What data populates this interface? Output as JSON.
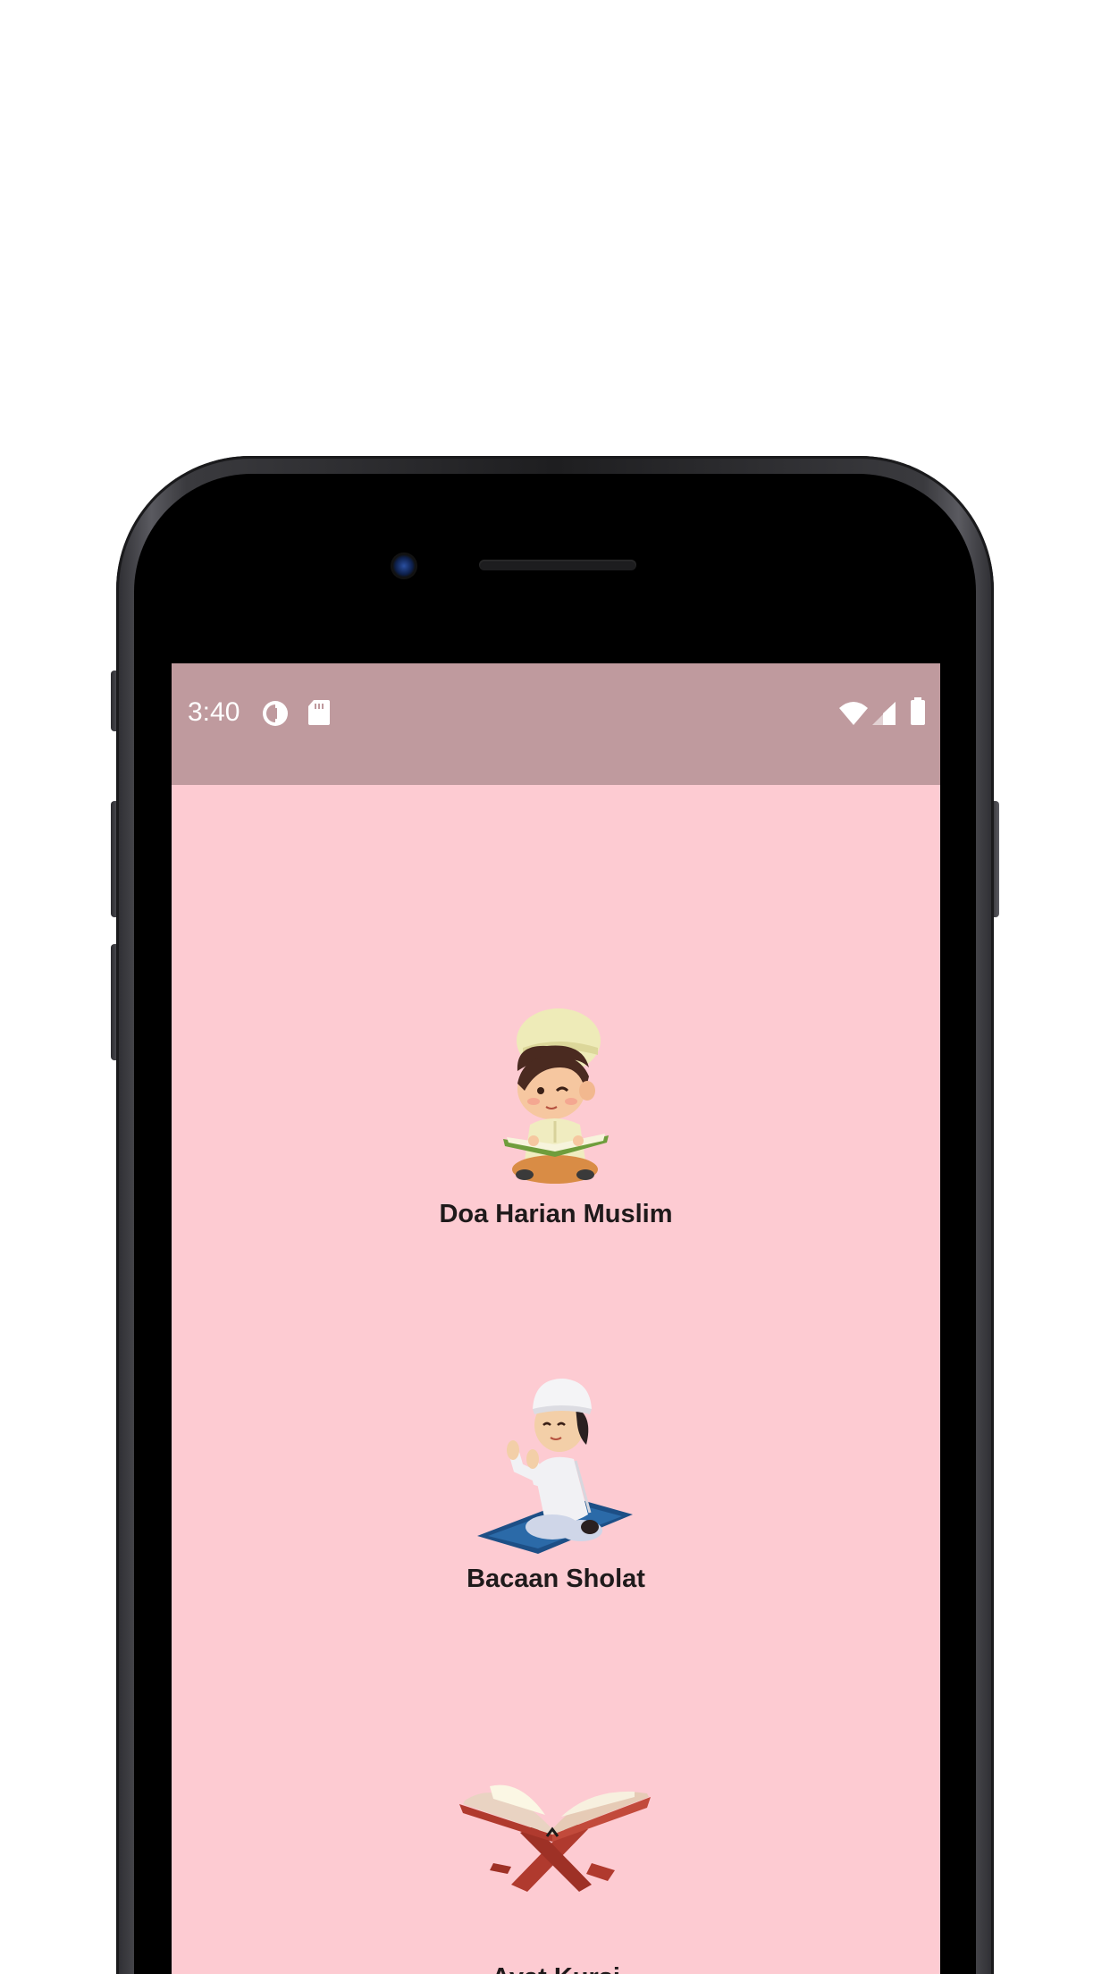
{
  "status_bar": {
    "time": "3:40",
    "left_icons": [
      "data-saver-icon",
      "sd-card-icon"
    ],
    "right_icons": [
      "wifi-icon",
      "cell-signal-icon",
      "battery-icon"
    ],
    "background_color": "#bf9a9e"
  },
  "screen": {
    "background_color": "#fdcbd2"
  },
  "menu": {
    "items": [
      {
        "label": "Doa Harian Muslim",
        "icon": "boy-reading-quran-icon"
      },
      {
        "label": "Bacaan Sholat",
        "icon": "boy-praying-icon"
      },
      {
        "label": "Ayat Kursi",
        "icon": "quran-on-stand-icon"
      }
    ]
  }
}
